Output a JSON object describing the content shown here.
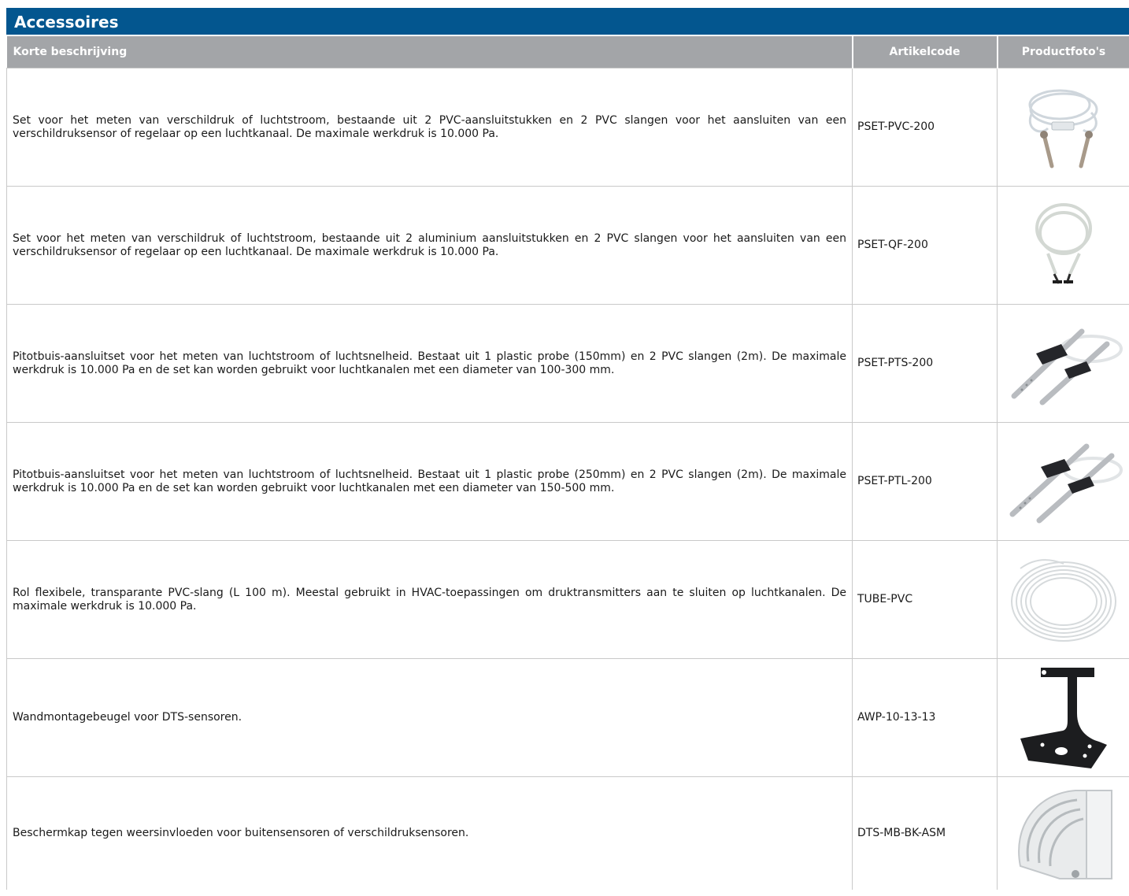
{
  "section": {
    "title": "Accessoires"
  },
  "columns": {
    "description": "Korte beschrijving",
    "code": "Artikelcode",
    "photo": "Productfoto's"
  },
  "rows": [
    {
      "description": "Set voor het meten van verschildruk of luchtstroom, bestaande uit 2 PVC-aansluitstukken en 2 PVC slangen voor het aansluiten van een verschildruksensor of regelaar op een luchtkanaal. De maximale werkdruk is 10.000 Pa.",
      "code": "PSET-PVC-200",
      "photo_icon": "tube-set-pvc-image"
    },
    {
      "description": "Set voor het meten van verschildruk of luchtstroom, bestaande uit 2 aluminium aansluitstukken en 2 PVC slangen voor het aansluiten van een verschildruksensor of regelaar op een luchtkanaal. De maximale werkdruk is 10.000 Pa.",
      "code": "PSET-QF-200",
      "photo_icon": "tube-set-aluminium-image"
    },
    {
      "description": "Pitotbuis-aansluitset voor het meten van luchtstroom of luchtsnelheid. Bestaat uit 1 plastic probe (150mm) en 2 PVC slangen (2m). De maximale werkdruk is 10.000 Pa en de set kan worden gebruikt voor luchtkanalen met een diameter van 100-300 mm.",
      "code": "PSET-PTS-200",
      "photo_icon": "pitot-probe-image"
    },
    {
      "description": "Pitotbuis-aansluitset voor het meten van luchtstroom of luchtsnelheid. Bestaat uit 1 plastic probe (250mm) en 2 PVC slangen (2m). De maximale werkdruk is 10.000 Pa en de set kan worden gebruikt voor luchtkanalen met een diameter van 150-500 mm.",
      "code": "PSET-PTL-200",
      "photo_icon": "pitot-probe-long-image"
    },
    {
      "description": "Rol flexibele, transparante PVC-slang (L 100 m). Meestal gebruikt in HVAC-toepassingen om druktransmitters aan te sluiten op luchtkanalen. De maximale werkdruk is 10.000 Pa.",
      "code": "TUBE-PVC",
      "photo_icon": "tube-coil-image"
    },
    {
      "description": "Wandmontagebeugel voor DTS-sensoren.",
      "code": "AWP-10-13-13",
      "photo_icon": "wall-bracket-image"
    },
    {
      "description": "Beschermkap tegen weersinvloeden voor buitensensoren of verschildruksensoren.",
      "code": "DTS-MB-BK-ASM",
      "photo_icon": "weather-shield-image"
    }
  ]
}
